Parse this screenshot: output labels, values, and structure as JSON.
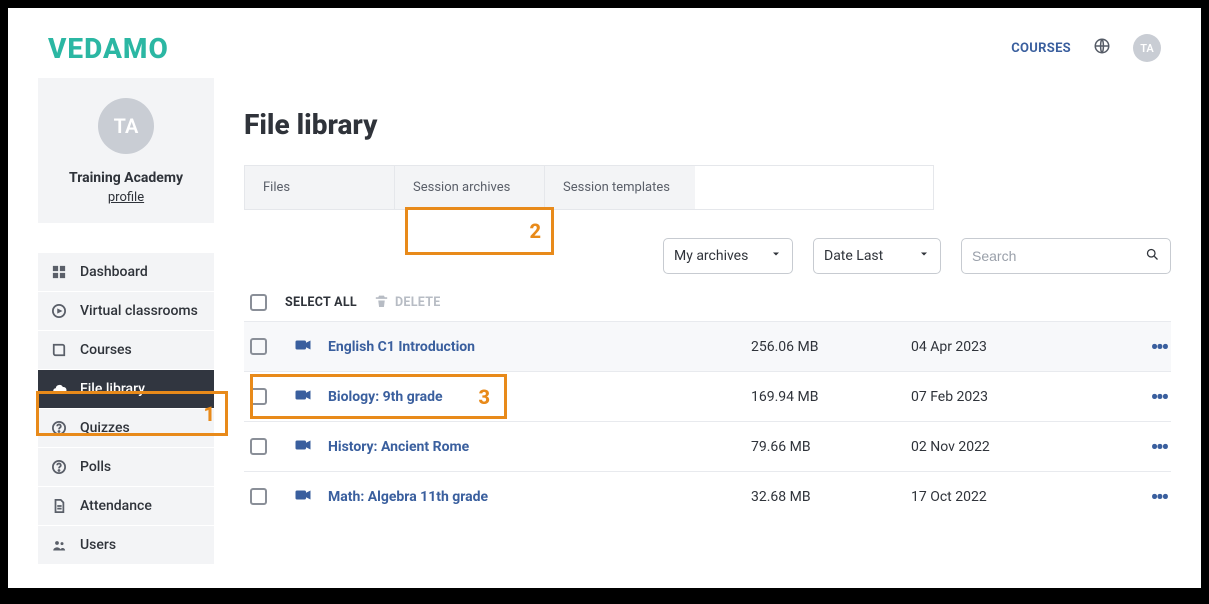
{
  "brand": "VEDAMO",
  "header": {
    "courses_link": "COURSES",
    "avatar_initials": "TA"
  },
  "org": {
    "avatar_initials": "TA",
    "name": "Training Academy",
    "profile_link": "profile"
  },
  "sidebar": {
    "items": [
      {
        "label": "Dashboard"
      },
      {
        "label": "Virtual classrooms"
      },
      {
        "label": "Courses"
      },
      {
        "label": "File library"
      },
      {
        "label": "Quizzes"
      },
      {
        "label": "Polls"
      },
      {
        "label": "Attendance"
      },
      {
        "label": "Users"
      }
    ]
  },
  "page": {
    "title": "File library"
  },
  "tabs": {
    "files": "Files",
    "archives": "Session archives",
    "templates": "Session templates"
  },
  "filters": {
    "archive_scope": "My archives",
    "sort": "Date Last",
    "search_placeholder": "Search"
  },
  "bulk": {
    "select_all": "SELECT ALL",
    "delete": "DELETE"
  },
  "rows": [
    {
      "name": "English C1 Introduction",
      "size": "256.06 MB",
      "date": "04 Apr 2023"
    },
    {
      "name": "Biology: 9th grade",
      "size": "169.94 MB",
      "date": "07 Feb 2023"
    },
    {
      "name": "History: Ancient Rome",
      "size": "79.66 MB",
      "date": "02 Nov 2022"
    },
    {
      "name": "Math: Algebra 11th grade",
      "size": "32.68 MB",
      "date": "17 Oct 2022"
    }
  ],
  "annotations": {
    "one": "1",
    "two": "2",
    "three": "3"
  }
}
